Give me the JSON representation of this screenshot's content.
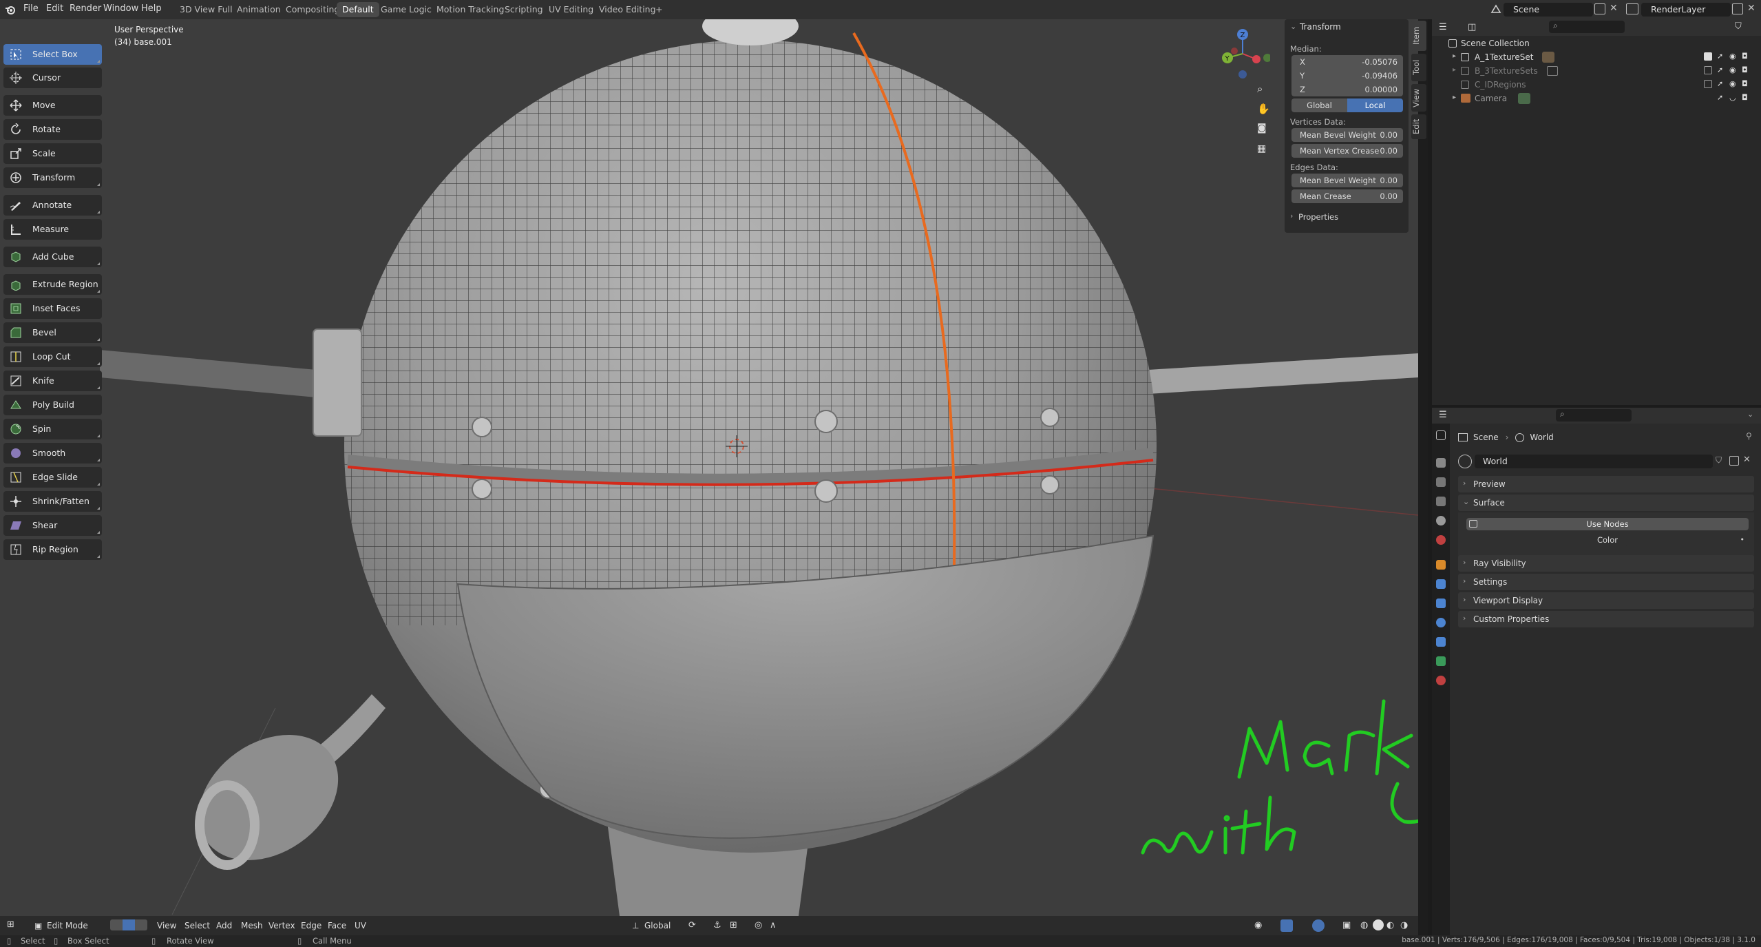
{
  "menu": {
    "items": [
      "File",
      "Edit",
      "Render",
      "Window",
      "Help"
    ],
    "workspaces": [
      "3D View Full",
      "Animation",
      "Compositing",
      "Default",
      "Game Logic",
      "Motion Tracking",
      "Scripting",
      "UV Editing",
      "Video Editing"
    ],
    "active_workspace": "Default",
    "add_tab": "+"
  },
  "scene_field": "Scene",
  "renderlayer_field": "RenderLayer",
  "viewport": {
    "perspective": "User Perspective",
    "object_info": "(34) base.001"
  },
  "toolbar": {
    "tools": [
      {
        "label": "Select Box",
        "icon": "select-box-icon"
      },
      {
        "label": "Cursor",
        "icon": "cursor-icon"
      },
      {
        "label": "Move",
        "icon": "move-icon"
      },
      {
        "label": "Rotate",
        "icon": "rotate-icon"
      },
      {
        "label": "Scale",
        "icon": "scale-icon"
      },
      {
        "label": "Transform",
        "icon": "transform-icon"
      },
      {
        "label": "Annotate",
        "icon": "annotate-icon"
      },
      {
        "label": "Measure",
        "icon": "measure-icon"
      },
      {
        "label": "Add Cube",
        "icon": "add-cube-icon"
      },
      {
        "label": "Extrude Region",
        "icon": "extrude-icon"
      },
      {
        "label": "Inset Faces",
        "icon": "inset-icon"
      },
      {
        "label": "Bevel",
        "icon": "bevel-icon"
      },
      {
        "label": "Loop Cut",
        "icon": "loop-cut-icon"
      },
      {
        "label": "Knife",
        "icon": "knife-icon"
      },
      {
        "label": "Poly Build",
        "icon": "poly-build-icon"
      },
      {
        "label": "Spin",
        "icon": "spin-icon"
      },
      {
        "label": "Smooth",
        "icon": "smooth-icon"
      },
      {
        "label": "Edge Slide",
        "icon": "edge-slide-icon"
      },
      {
        "label": "Shrink/Fatten",
        "icon": "shrink-fatten-icon"
      },
      {
        "label": "Shear",
        "icon": "shear-icon"
      },
      {
        "label": "Rip Region",
        "icon": "rip-region-icon"
      }
    ]
  },
  "npanel": {
    "header": "Transform",
    "median_label": "Median:",
    "x_label": "X",
    "x_value": "-0.05076",
    "y_label": "Y",
    "y_value": "-0.09406",
    "z_label": "Z",
    "z_value": "0.00000",
    "global_btn": "Global",
    "local_btn": "Local",
    "vertices_label": "Vertices Data:",
    "v_bevel_label": "Mean Bevel Weight",
    "v_bevel_value": "0.00",
    "v_crease_label": "Mean Vertex Crease",
    "v_crease_value": "0.00",
    "edges_label": "Edges Data:",
    "e_bevel_label": "Mean Bevel Weight",
    "e_bevel_value": "0.00",
    "e_crease_label": "Mean Crease",
    "e_crease_value": "0.00",
    "properties_label": "Properties",
    "tabs": [
      "Item",
      "Tool",
      "View",
      "Edit"
    ]
  },
  "outliner": {
    "root": "Scene Collection",
    "rows": [
      {
        "label": "A_1TextureSet"
      },
      {
        "label": "B_3TextureSets"
      },
      {
        "label": "C_IDRegions"
      },
      {
        "label": "Camera"
      }
    ]
  },
  "properties": {
    "breadcrumb_scene": "Scene",
    "breadcrumb_sep": "›",
    "breadcrumb_world": "World",
    "world_field": "World",
    "preview": "Preview",
    "surface": "Surface",
    "use_nodes": "Use Nodes",
    "color_label": "Color",
    "ray_visibility": "Ray Visibility",
    "settings": "Settings",
    "viewport_display": "Viewport Display",
    "custom_properties": "Custom Properties"
  },
  "viewport_header": {
    "mode": "Edit Mode",
    "menus": [
      "View",
      "Select",
      "Add",
      "Mesh",
      "Vertex",
      "Edge",
      "Face",
      "UV"
    ],
    "orientation": "Global"
  },
  "statusbar": {
    "select": "Select",
    "box_select": "Box Select",
    "rotate_view": "Rotate View",
    "call_menu": "Call Menu",
    "stats": "base.001 | Verts:176/9,506 | Edges:176/19,008 | Faces:0/9,504 | Tris:19,008 | Objects:1/38 | 3.1.0"
  },
  "annotation": {
    "text": "with Mark Seams U Key",
    "color": "#22cc22"
  },
  "colors": {
    "accent": "#4772b3",
    "seam": "#e86a1f",
    "selected_edge": "#d42a1a"
  }
}
